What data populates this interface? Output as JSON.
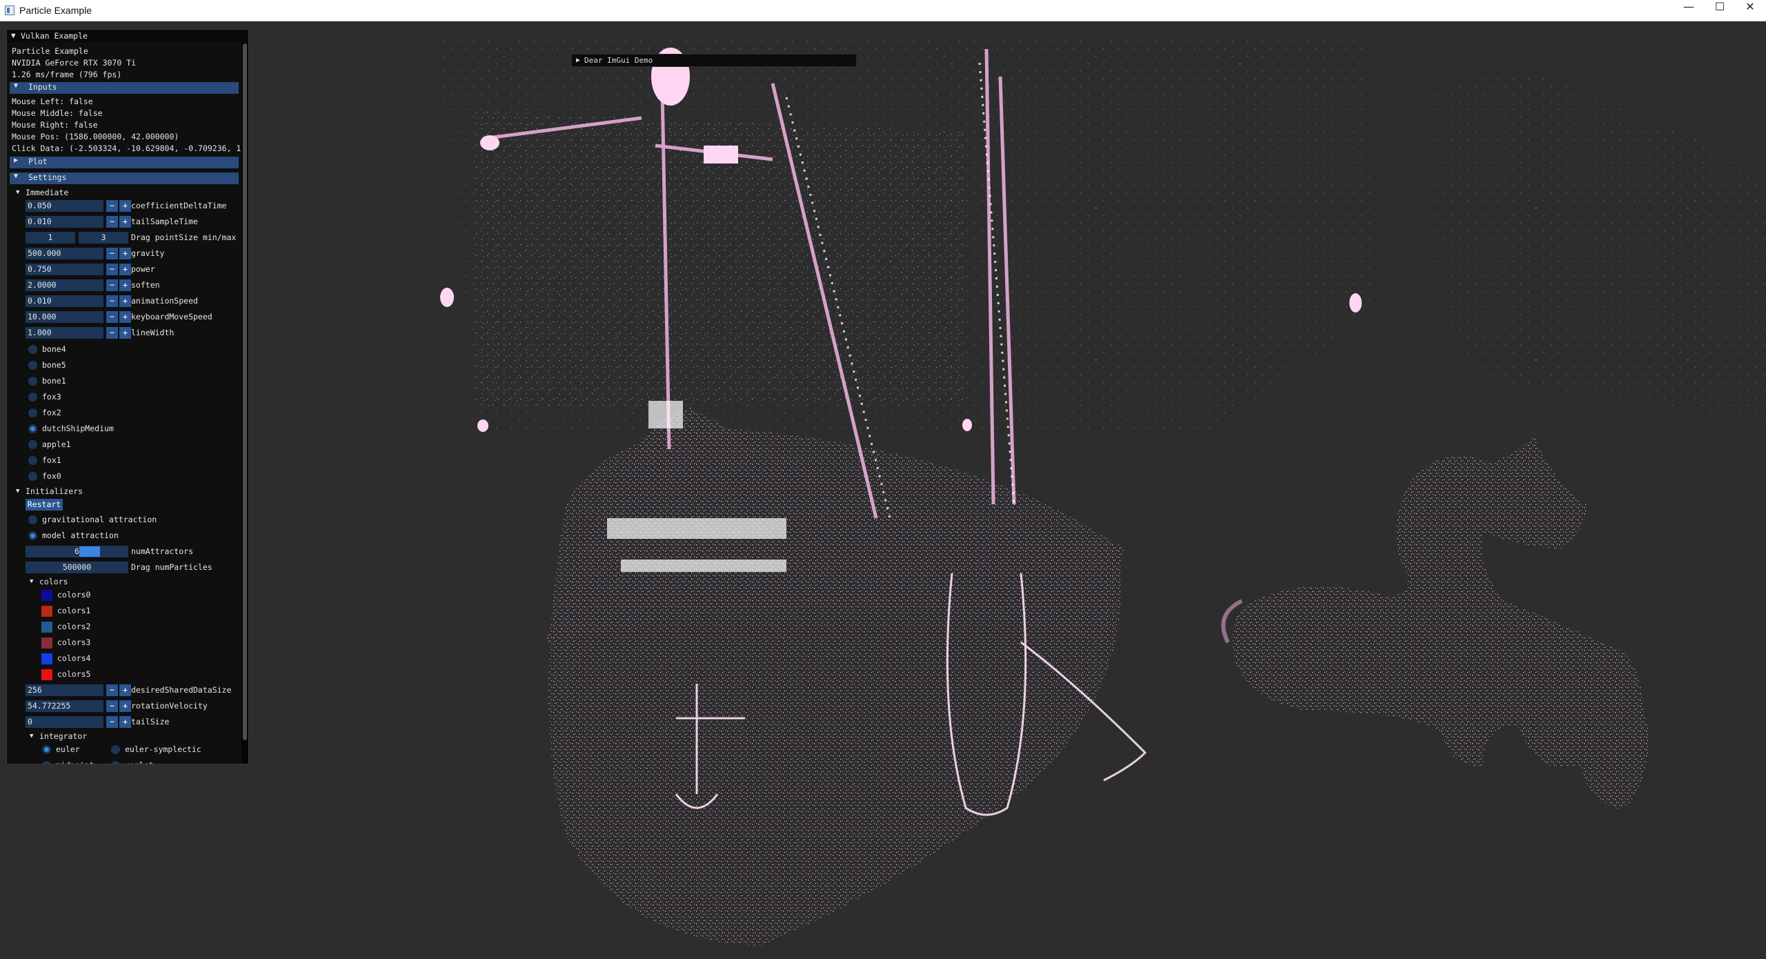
{
  "window": {
    "title": "Particle Example"
  },
  "controls": {
    "minimize": "—",
    "maximize": "☐",
    "close": "✕"
  },
  "demo_window": {
    "title": "Dear ImGui Demo"
  },
  "panel": {
    "title": "Vulkan Example",
    "info": [
      "Particle Example",
      "NVIDIA GeForce RTX 3070 Ti",
      "1.26 ms/frame (796 fps)"
    ],
    "inputs": {
      "header": "Inputs",
      "lines": [
        "Mouse Left: false",
        "Mouse Middle: false",
        "Mouse Right: false",
        "Mouse Pos: (1586.000000, 42.000000)",
        "Click Data: (-2.503324, -10.629804, -0.709236, 1"
      ]
    },
    "plot": {
      "header": "Plot"
    },
    "settings": {
      "header": "Settings",
      "immediate": {
        "label": "Immediate",
        "fields": [
          {
            "value": "0.050",
            "label": "coefficientDeltaTime"
          },
          {
            "value": "0.010",
            "label": "tailSampleTime"
          }
        ],
        "point_size": {
          "min": "1",
          "max": "3",
          "label": "Drag pointSize min/max"
        },
        "fields2": [
          {
            "value": "500.000",
            "label": "gravity"
          },
          {
            "value": "0.750",
            "label": "power"
          },
          {
            "value": "2.0000",
            "label": "soften"
          },
          {
            "value": "0.010",
            "label": "animationSpeed"
          },
          {
            "value": "10.000",
            "label": "keyboardMoveSpeed"
          },
          {
            "value": "1.000",
            "label": "lineWidth"
          }
        ],
        "models": [
          {
            "label": "bone4",
            "selected": false
          },
          {
            "label": "bone5",
            "selected": false
          },
          {
            "label": "bone1",
            "selected": false
          },
          {
            "label": "fox3",
            "selected": false
          },
          {
            "label": "fox2",
            "selected": false
          },
          {
            "label": "dutchShipMedium",
            "selected": true
          },
          {
            "label": "apple1",
            "selected": false
          },
          {
            "label": "fox1",
            "selected": false
          },
          {
            "label": "fox0",
            "selected": false
          }
        ]
      },
      "initializers": {
        "label": "Initializers",
        "restart": "Restart",
        "modes": [
          {
            "label": "gravitational attraction",
            "selected": false
          },
          {
            "label": "model attraction",
            "selected": true
          }
        ],
        "num_attractors": {
          "value": "6",
          "label": "numAttractors",
          "fill": 0.17
        },
        "num_particles": {
          "value": "500000",
          "label": "Drag numParticles"
        },
        "colors": {
          "label": "colors",
          "items": [
            {
              "label": "colors0",
              "color": "#0b0ba0"
            },
            {
              "label": "colors1",
              "color": "#b82a12"
            },
            {
              "label": "colors2",
              "color": "#245a92"
            },
            {
              "label": "colors3",
              "color": "#8a2a3a"
            },
            {
              "label": "colors4",
              "color": "#1240e6"
            },
            {
              "label": "colors5",
              "color": "#e81212"
            }
          ]
        },
        "fields": [
          {
            "value": "256",
            "label": "desiredSharedDataSize"
          },
          {
            "value": "54.772255",
            "label": "rotationVelocity"
          },
          {
            "value": "0",
            "label": "tailSize"
          }
        ],
        "integrator": {
          "label": "integrator",
          "options": [
            {
              "label": "euler",
              "selected": true
            },
            {
              "label": "euler-symplectic",
              "selected": false
            },
            {
              "label": "midpoint",
              "selected": false
            },
            {
              "label": "verlet",
              "selected": false
            }
          ]
        }
      }
    },
    "buttons": {
      "minus": "−",
      "plus": "+"
    }
  },
  "icons": {
    "collapse": "▼",
    "expand": "▶"
  }
}
